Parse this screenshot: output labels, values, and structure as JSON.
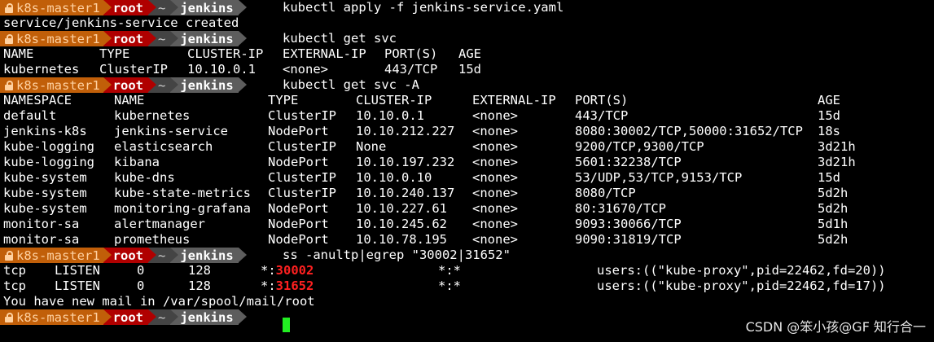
{
  "prompt": {
    "host": "k8s-master1",
    "user": "root",
    "tilde": "~",
    "dir": "jenkins"
  },
  "colors": {
    "host_bg": "#c15f09",
    "user_bg": "#b00000",
    "dir_bg": "#5d5d5d",
    "cursor": "#22ee22",
    "port_highlight": "#ff2020"
  },
  "commands": [
    "kubectl apply -f jenkins-service.yaml",
    "kubectl get svc",
    "kubectl get svc -A",
    "ss -anultp|egrep \"30002|31652\""
  ],
  "output1": "service/jenkins-service created",
  "svc_table": {
    "headers": [
      "NAME",
      "TYPE",
      "CLUSTER-IP",
      "EXTERNAL-IP",
      "PORT(S)",
      "AGE"
    ],
    "rows": [
      [
        "kubernetes",
        "ClusterIP",
        "10.10.0.1",
        "<none>",
        "443/TCP",
        "15d"
      ]
    ]
  },
  "svc_all_table": {
    "headers": [
      "NAMESPACE",
      "NAME",
      "TYPE",
      "CLUSTER-IP",
      "EXTERNAL-IP",
      "PORT(S)",
      "AGE"
    ],
    "rows": [
      [
        "default",
        "kubernetes",
        "ClusterIP",
        "10.10.0.1",
        "<none>",
        "443/TCP",
        "15d"
      ],
      [
        "jenkins-k8s",
        "jenkins-service",
        "NodePort",
        "10.10.212.227",
        "<none>",
        "8080:30002/TCP,50000:31652/TCP",
        "18s"
      ],
      [
        "kube-logging",
        "elasticsearch",
        "ClusterIP",
        "None",
        "<none>",
        "9200/TCP,9300/TCP",
        "3d21h"
      ],
      [
        "kube-logging",
        "kibana",
        "NodePort",
        "10.10.197.232",
        "<none>",
        "5601:32238/TCP",
        "3d21h"
      ],
      [
        "kube-system",
        "kube-dns",
        "ClusterIP",
        "10.10.0.10",
        "<none>",
        "53/UDP,53/TCP,9153/TCP",
        "15d"
      ],
      [
        "kube-system",
        "kube-state-metrics",
        "ClusterIP",
        "10.10.240.137",
        "<none>",
        "8080/TCP",
        "5d2h"
      ],
      [
        "kube-system",
        "monitoring-grafana",
        "NodePort",
        "10.10.227.61",
        "<none>",
        "80:31670/TCP",
        "5d2h"
      ],
      [
        "monitor-sa",
        "alertmanager",
        "NodePort",
        "10.10.245.62",
        "<none>",
        "9093:30066/TCP",
        "5d1h"
      ],
      [
        "monitor-sa",
        "prometheus",
        "NodePort",
        "10.10.78.195",
        "<none>",
        "9090:31819/TCP",
        "5d2h"
      ]
    ]
  },
  "ss_rows": [
    {
      "proto": "tcp",
      "state": "LISTEN",
      "recvq": "0",
      "sendq": "128",
      "local_prefix": "*:",
      "local_port": "30002",
      "peer": "*:*",
      "process": "users:((\"kube-proxy\",pid=22462,fd=20))"
    },
    {
      "proto": "tcp",
      "state": "LISTEN",
      "recvq": "0",
      "sendq": "128",
      "local_prefix": "*:",
      "local_port": "31652",
      "peer": "*:*",
      "process": "users:((\"kube-proxy\",pid=22462,fd=17))"
    }
  ],
  "mail_notice": "You have new mail in /var/spool/mail/root",
  "watermark": "CSDN @笨小孩@GF 知行合一"
}
